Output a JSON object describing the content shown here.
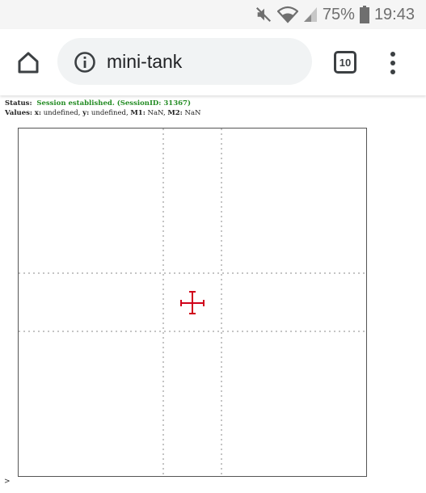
{
  "statusbar": {
    "mute_icon": "mute-icon",
    "wifi_icon": "wifi-icon",
    "signal_icon": "signal-icon",
    "battery_pct": "75%",
    "battery_icon": "battery-icon",
    "time": "19:43"
  },
  "toolbar": {
    "home_icon": "home-icon",
    "info_icon": "info-icon",
    "url": "mini-tank",
    "tab_count": "10",
    "menu_icon": "kebab-menu-icon"
  },
  "page": {
    "status_label": "Status:",
    "status_value": "Session established. (SessionID: 31367)",
    "values_label": "Values:",
    "x_label": "x:",
    "x_value": "undefined,",
    "y_label": "y:",
    "y_value": "undefined,",
    "m1_label": "M1:",
    "m1_value": "NaN,",
    "m2_label": "M2:",
    "m2_value": "NaN",
    "prompt": ">"
  },
  "colors": {
    "status_ok": "#228B22",
    "crosshair": "#d0021b"
  }
}
